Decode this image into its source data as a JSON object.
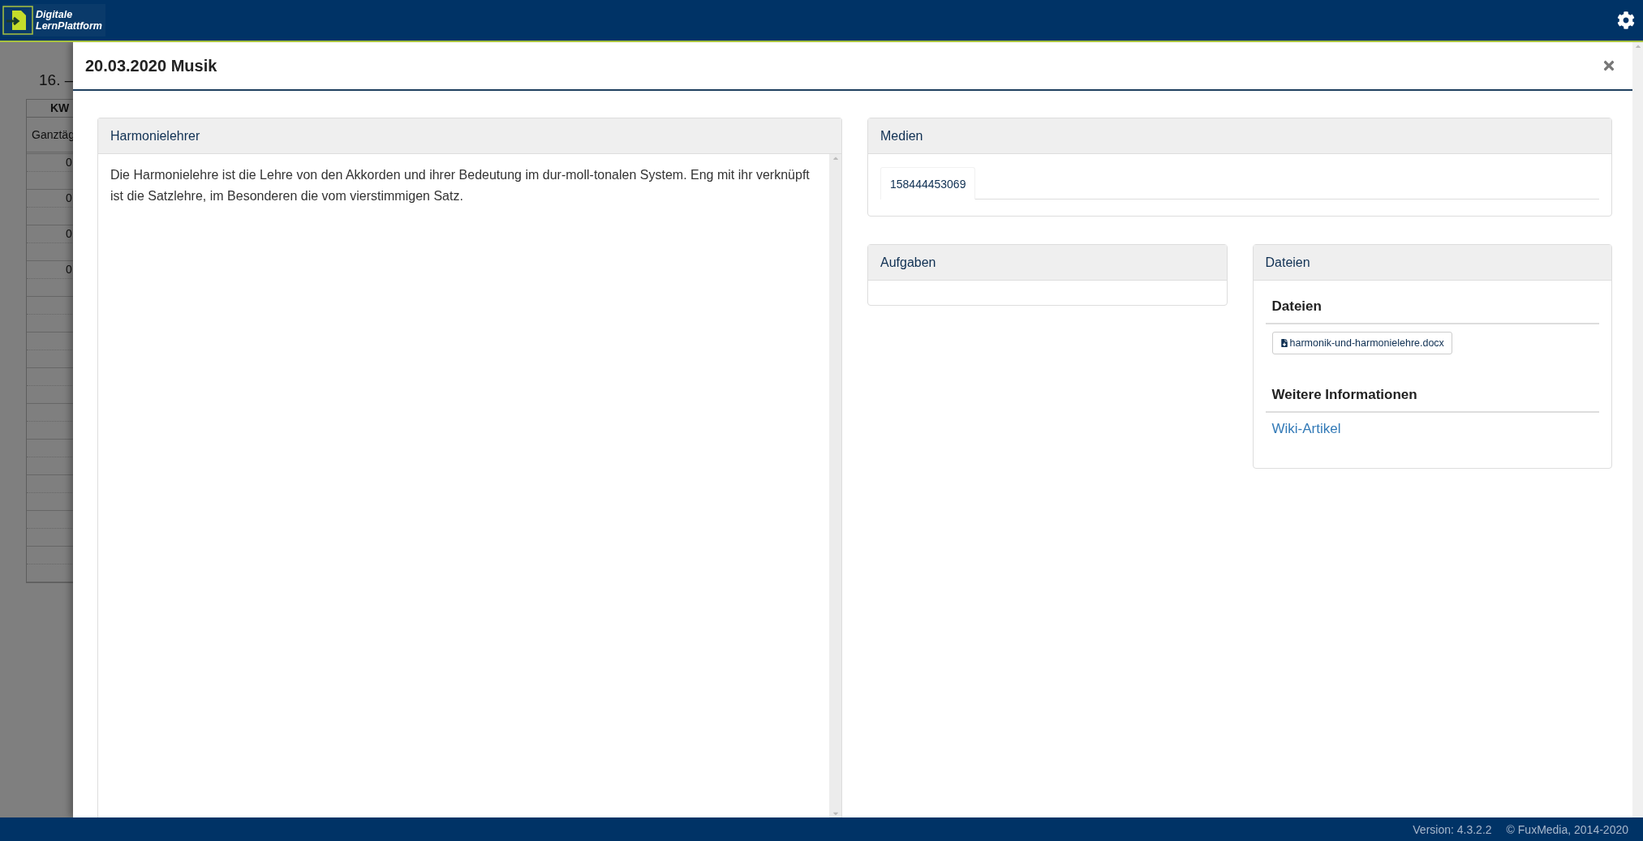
{
  "header": {
    "logo": {
      "line1": "Digitale",
      "line2": "LernPlattform"
    }
  },
  "background": {
    "heading": "16. –",
    "table": {
      "column_1": "KW",
      "row_label": "Ganztäg",
      "cells": [
        "0",
        "0",
        "0",
        "0"
      ]
    }
  },
  "modal": {
    "title": "20.03.2020 Musik",
    "content_panel": {
      "title": "Harmonielehrer",
      "text": "Die Harmonielehre ist die Lehre von den Akkorden und ihrer Bedeutung im dur-moll-tonalen System. Eng mit ihr verknüpft ist die Satzlehre, im Besonderen die vom vierstimmigen Satz."
    },
    "media_panel": {
      "title": "Medien",
      "tabs": [
        {
          "label": "158444453069",
          "selected": true
        }
      ]
    },
    "tasks_panel": {
      "title": "Aufgaben"
    },
    "files_panel": {
      "title": "Dateien",
      "sections": [
        {
          "kind": "files",
          "heading": "Dateien",
          "items": [
            "harmonik-und-harmonielehre.docx"
          ]
        },
        {
          "kind": "links",
          "heading": "Weitere Informationen",
          "items": [
            "Wiki-Artikel"
          ]
        }
      ]
    }
  },
  "footer": {
    "version": "Version: 4.3.2.2",
    "copyright": "© FuxMedia, 2014-2020"
  }
}
